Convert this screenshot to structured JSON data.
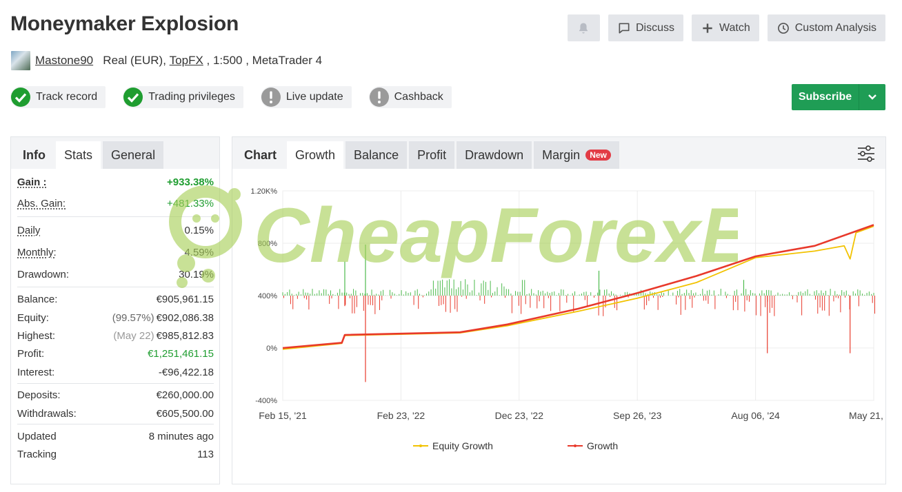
{
  "header": {
    "title": "Moneymaker Explosion",
    "actions": {
      "discuss": "Discuss",
      "watch": "Watch",
      "custom": "Custom Analysis"
    }
  },
  "account": {
    "username": "Mastone90",
    "type": "Real (EUR), ",
    "broker": "TopFX",
    "rest": " , 1:500 , MetaTrader 4"
  },
  "badges": [
    {
      "label": "Track record",
      "status": "verified",
      "color": "#1f9d30"
    },
    {
      "label": "Trading privileges",
      "status": "verified",
      "color": "#1f9d30"
    },
    {
      "label": "Live update",
      "status": "warning",
      "color": "#9a9a9a"
    },
    {
      "label": "Cashback",
      "status": "warning",
      "color": "#9a9a9a"
    }
  ],
  "subscribe": {
    "label": "Subscribe",
    "color": "#1f9d55"
  },
  "left_tabs": {
    "title": "Info",
    "stats": "Stats",
    "general": "General"
  },
  "stats": {
    "gain_label": "Gain :",
    "gain": "+933.38%",
    "abs_gain_label": "Abs. Gain:",
    "abs_gain": "+481.33%",
    "daily_label": "Daily",
    "daily": "0.15%",
    "monthly_label": "Monthly:",
    "monthly": "4.59%",
    "drawdown_label": "Drawdown:",
    "drawdown": "30.19%",
    "balance_label": "Balance:",
    "balance": "€905,961.15",
    "equity_label": "Equity:",
    "equity_pct": "(99.57%)",
    "equity": "€902,086.38",
    "highest_label": "Highest:",
    "highest_date": "(May 22)",
    "highest": "€985,812.83",
    "profit_label": "Profit:",
    "profit": "€1,251,461.15",
    "interest_label": "Interest:",
    "interest": "-€96,422.18",
    "deposits_label": "Deposits:",
    "deposits": "€260,000.00",
    "withdrawals_label": "Withdrawals:",
    "withdrawals": "€605,500.00",
    "updated_label": "Updated",
    "updated": "8 minutes ago",
    "tracking_label": "Tracking",
    "tracking": "113"
  },
  "chart_tabs": {
    "title": "Chart",
    "growth": "Growth",
    "balance": "Balance",
    "profit": "Profit",
    "drawdown": "Drawdown",
    "margin": "Margin",
    "new_badge": "New"
  },
  "watermark": "CheapForexEa",
  "chart_data": {
    "type": "line",
    "x_ticks": [
      "Feb 15, '21",
      "Feb 23, '22",
      "Dec 23, '22",
      "Sep 26, '23",
      "Aug 06, '24",
      "May 21, '25"
    ],
    "y_ticks": [
      "1.20K%",
      "800%",
      "400%",
      "0%",
      "-400%"
    ],
    "ylim": [
      -400,
      1200
    ],
    "grid": true,
    "legend_position": "bottom",
    "series": [
      {
        "name": "Growth",
        "color": "#e8392b",
        "points": [
          [
            0,
            0
          ],
          [
            0.1,
            40
          ],
          [
            0.105,
            100
          ],
          [
            0.3,
            120
          ],
          [
            0.38,
            180
          ],
          [
            0.5,
            300
          ],
          [
            0.6,
            420
          ],
          [
            0.7,
            550
          ],
          [
            0.8,
            700
          ],
          [
            0.9,
            780
          ],
          [
            1.0,
            940
          ]
        ]
      },
      {
        "name": "Equity Growth",
        "color": "#f2c200",
        "points": [
          [
            0,
            -10
          ],
          [
            0.1,
            35
          ],
          [
            0.105,
            95
          ],
          [
            0.3,
            115
          ],
          [
            0.38,
            170
          ],
          [
            0.5,
            280
          ],
          [
            0.6,
            380
          ],
          [
            0.7,
            500
          ],
          [
            0.8,
            690
          ],
          [
            0.9,
            740
          ],
          [
            0.95,
            780
          ],
          [
            0.96,
            680
          ],
          [
            0.97,
            880
          ],
          [
            1.0,
            930
          ]
        ]
      }
    ],
    "bars_note": "daily profit/loss spikes around 400% baseline; green = positive, red = negative"
  }
}
